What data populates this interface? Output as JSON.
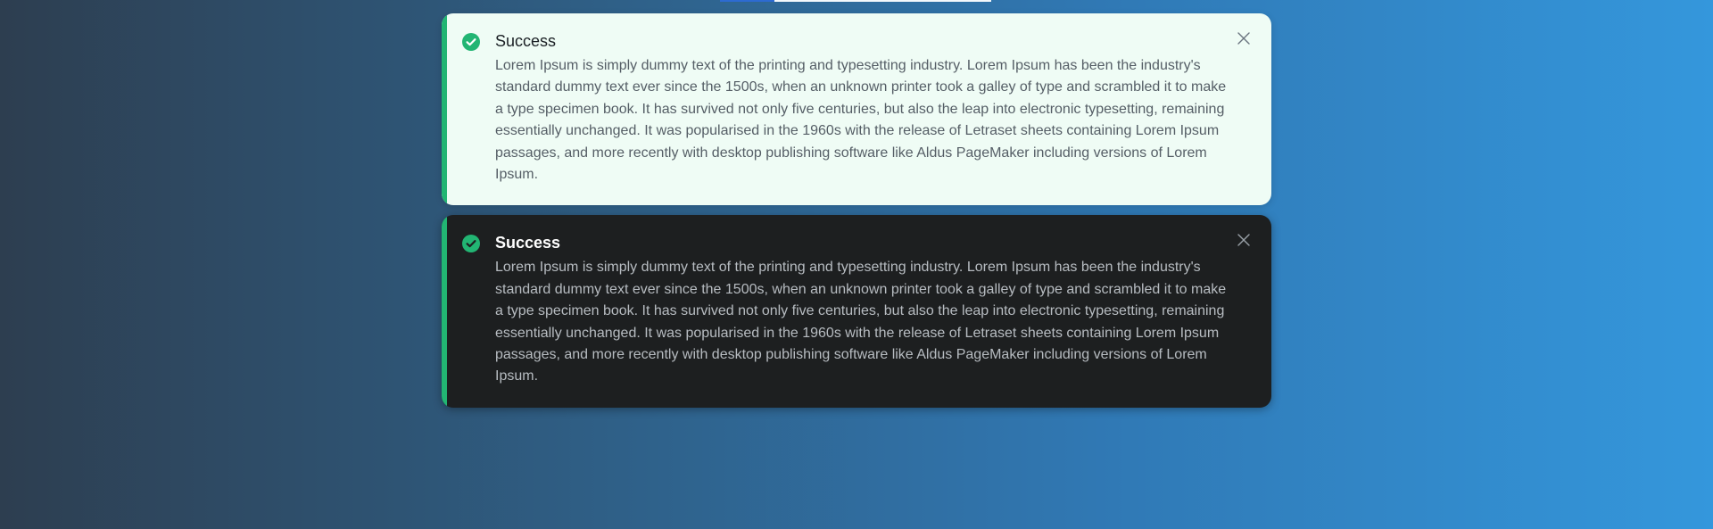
{
  "colors": {
    "accent": "#22b573",
    "light_toast_bg": "#effcf5",
    "dark_toast_bg": "#1d1f20",
    "background_left": "#2d3e50",
    "background_right": "#3497dc"
  },
  "toasts": [
    {
      "variant": "light",
      "icon": "check-circle-icon",
      "title": "Success",
      "message": "Lorem Ipsum is simply dummy text of the printing and typesetting industry. Lorem Ipsum has been the industry's standard dummy text ever since the 1500s, when an unknown printer took a galley of type and scrambled it to make a type specimen book. It has survived not only five centuries, but also the leap into electronic typesetting, remaining essentially unchanged. It was popularised in the 1960s with the release of Letraset sheets containing Lorem Ipsum passages, and more recently with desktop publishing software like Aldus PageMaker including versions of Lorem Ipsum.",
      "close_icon": "close-icon"
    },
    {
      "variant": "dark",
      "icon": "check-circle-icon",
      "title": "Success",
      "message": "Lorem Ipsum is simply dummy text of the printing and typesetting industry. Lorem Ipsum has been the industry's standard dummy text ever since the 1500s, when an unknown printer took a galley of type and scrambled it to make a type specimen book. It has survived not only five centuries, but also the leap into electronic typesetting, remaining essentially unchanged. It was popularised in the 1960s with the release of Letraset sheets containing Lorem Ipsum passages, and more recently with desktop publishing software like Aldus PageMaker including versions of Lorem Ipsum.",
      "close_icon": "close-icon"
    }
  ]
}
